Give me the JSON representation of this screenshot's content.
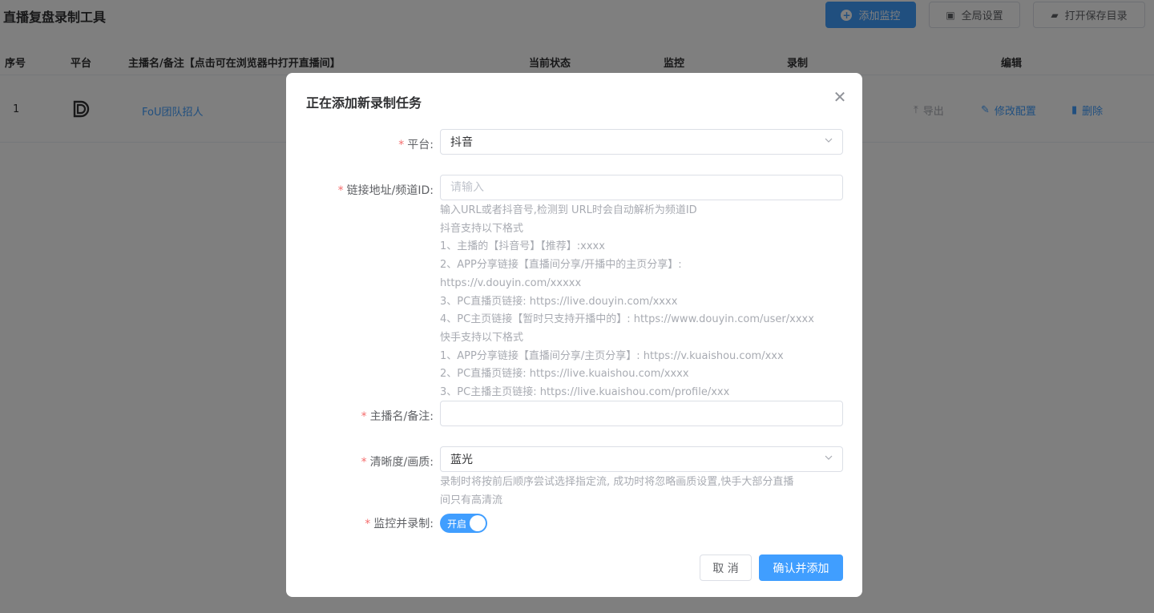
{
  "app": {
    "title": "直播复盘录制工具"
  },
  "toolbar": {
    "add_monitor": "添加监控",
    "global_settings": "全局设置",
    "open_save_dir": "打开保存目录"
  },
  "table": {
    "headers": {
      "index": "序号",
      "platform": "平台",
      "name": "主播名/备注【点击可在浏览器中打开直播间】",
      "status": "当前状态",
      "monitor": "监控",
      "record": "录制",
      "edit": "编辑"
    },
    "rows": [
      {
        "index": "1",
        "platform_icon": "douyin-d-logo",
        "name": "FoU团队招人",
        "export": "导出",
        "edit_config": "修改配置",
        "delete": "删除"
      }
    ]
  },
  "dialog": {
    "title": "正在添加新录制任务",
    "platform": {
      "label": "平台:",
      "value": "抖音"
    },
    "url": {
      "label": "链接地址/频道ID:",
      "placeholder": "请输入",
      "hints": [
        "输入URL或者抖音号,检测到 URL时会自动解析为频道ID",
        "抖音支持以下格式",
        "1、主播的【抖音号】【推荐】:xxxx",
        "2、APP分享链接【直播间分享/开播中的主页分享】:",
        "https://v.douyin.com/xxxxx",
        "3、PC直播页链接: https://live.douyin.com/xxxx",
        "4、PC主页链接【暂时只支持开播中的】: https://www.douyin.com/user/xxxx",
        "快手支持以下格式",
        "1、APP分享链接【直播间分享/主页分享】: https://v.kuaishou.com/xxx",
        "2、PC直播页链接: https://live.kuaishou.com/xxxx",
        "3、PC主播主页链接: https://live.kuaishou.com/profile/xxx"
      ]
    },
    "name": {
      "label": "主播名/备注:",
      "value": ""
    },
    "quality": {
      "label": "清晰度/画质:",
      "value": "蓝光",
      "hints": [
        "录制时将按前后顺序尝试选择指定流, 成功时将忽略画质设置,快手大部分直播",
        "间只有高清流"
      ]
    },
    "monitor_record": {
      "label": "监控并录制:",
      "switch_text": "开启",
      "on": true
    },
    "cancel": "取 消",
    "confirm": "确认并添加"
  },
  "colors": {
    "primary": "#409eff",
    "required": "#f56c6c",
    "hint": "#a8abb2"
  }
}
